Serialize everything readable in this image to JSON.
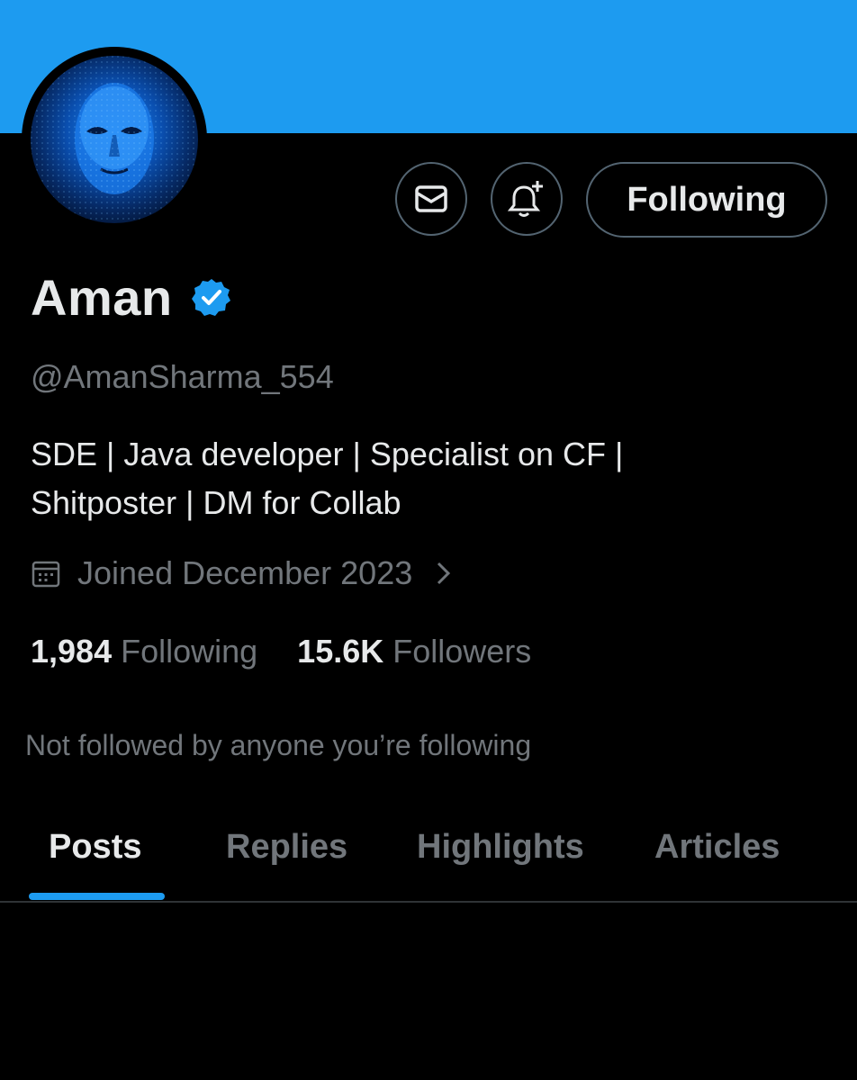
{
  "header": {
    "banner_color": "#1d9bf0",
    "avatar_icon": "masked-face-avatar"
  },
  "actions": {
    "message_icon": "envelope-icon",
    "notify_icon": "bell-plus-icon",
    "follow_label": "Following"
  },
  "profile": {
    "name": "Aman",
    "verified_icon": "verified-badge-icon",
    "handle": "@AmanSharma_554",
    "bio": "SDE | Java  developer | Specialist on CF |\nShitposter | DM for Collab",
    "joined": "Joined December 2023",
    "joined_icon": "calendar-icon",
    "chevron_icon": "chevron-right-icon"
  },
  "stats": {
    "following_count": "1,984",
    "following_label": "Following",
    "followers_count": "15.6K",
    "followers_label": "Followers"
  },
  "social_context": "Not followed by anyone you’re following",
  "tabs": [
    {
      "label": "Posts",
      "active": true
    },
    {
      "label": "Replies",
      "active": false
    },
    {
      "label": "Highlights",
      "active": false
    },
    {
      "label": "Articles",
      "active": false
    }
  ],
  "colors": {
    "accent": "#1d9bf0",
    "background": "#000000",
    "text_primary": "#e7e9ea",
    "text_secondary": "#71767b",
    "border": "#536471"
  }
}
